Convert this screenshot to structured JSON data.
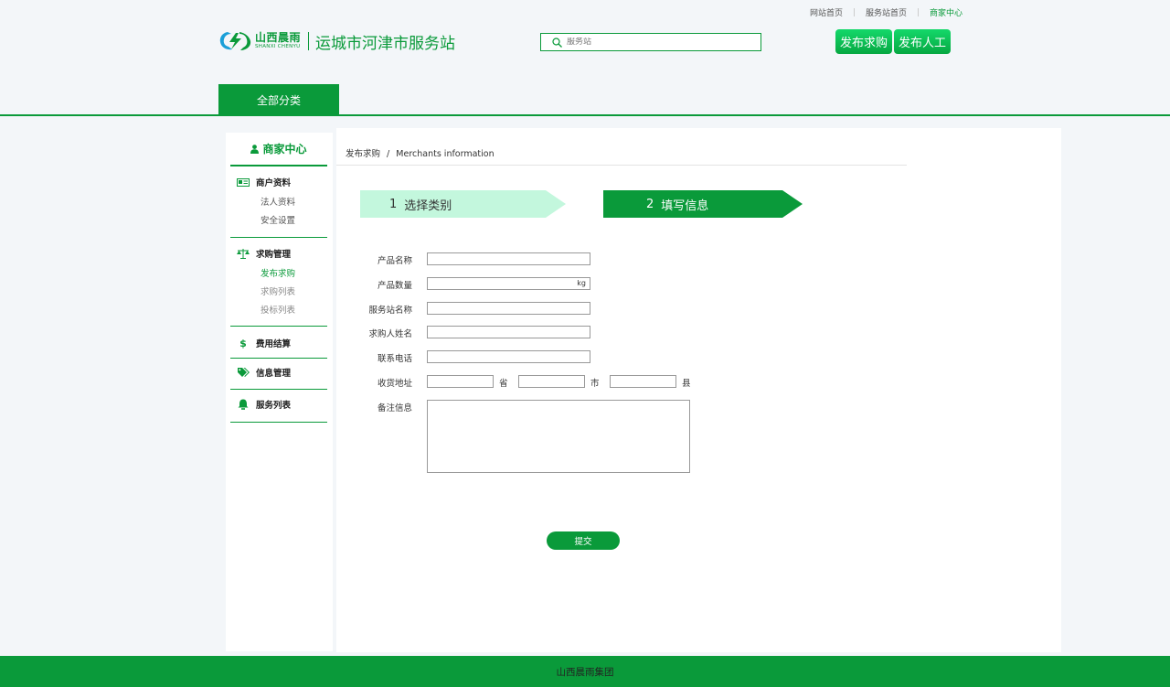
{
  "top_links": [
    "网站首页",
    "服务站首页",
    "商家中心"
  ],
  "logo": {
    "cn": "山西晨雨",
    "en": "SHANXI CHENYU"
  },
  "site_title": "运城市河津市服务站",
  "search": {
    "placeholder": "服务站"
  },
  "header_buttons": {
    "publish_purchase": "发布求购",
    "publish_labor": "发布人工"
  },
  "nav": {
    "all_categories": "全部分类"
  },
  "sidebar": {
    "title": "商家中心",
    "groups": [
      {
        "label": "商户资料",
        "icon": "id-card-icon",
        "items": [
          "法人资料",
          "安全设置"
        ]
      },
      {
        "label": "求购管理",
        "icon": "scale-icon",
        "items": [
          "发布求购",
          "求购列表",
          "投标列表"
        ],
        "active_item": "发布求购"
      },
      {
        "label": "费用结算",
        "icon": "dollar-icon",
        "items": []
      },
      {
        "label": "信息管理",
        "icon": "tags-icon",
        "items": []
      },
      {
        "label": "服务列表",
        "icon": "bell-icon",
        "items": []
      }
    ]
  },
  "breadcrumb": {
    "current": "发布求购",
    "separator": "/",
    "sub": "Merchants information"
  },
  "steps": [
    {
      "num": "1",
      "label": "选择类别",
      "state": "done"
    },
    {
      "num": "2",
      "label": "填写信息",
      "state": "active"
    }
  ],
  "form": {
    "product_name": {
      "label": "产品名称",
      "value": ""
    },
    "product_qty": {
      "label": "产品数量",
      "value": "",
      "unit": "kg"
    },
    "station_name": {
      "label": "服务站名称",
      "value": ""
    },
    "buyer_name": {
      "label": "求购人姓名",
      "value": ""
    },
    "phone": {
      "label": "联系电话",
      "value": ""
    },
    "address": {
      "label": "收货地址",
      "province": "省",
      "city": "市",
      "county": "县"
    },
    "remark": {
      "label": "备注信息",
      "value": ""
    },
    "submit_label": "提交"
  },
  "footer": {
    "text": "山西晨雨集团"
  },
  "colors": {
    "brand": "#0a9a3a",
    "step_done": "#c3f7dd",
    "button_gradient_top": "#14d86a"
  }
}
